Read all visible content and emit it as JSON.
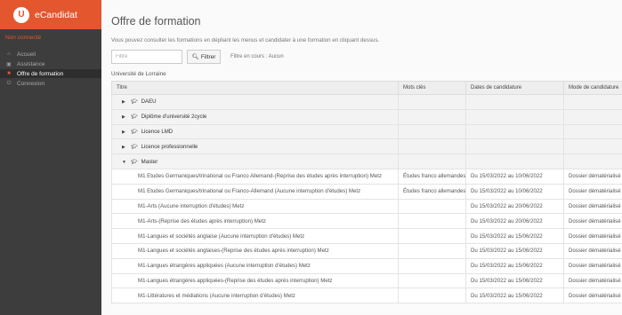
{
  "app": {
    "logo_letter": "U",
    "title": "eCandidat"
  },
  "user_status": "Non connecté",
  "nav": [
    {
      "icon": "home-icon",
      "glyph": "⌂",
      "label": "Accueil",
      "active": false
    },
    {
      "icon": "assistance-icon",
      "glyph": "▣",
      "label": "Assistance",
      "active": false
    },
    {
      "icon": "flag-icon",
      "glyph": "■",
      "label": "Offre de formation",
      "active": true
    },
    {
      "icon": "power-icon",
      "glyph": "⏻",
      "label": "Connexion",
      "active": false
    }
  ],
  "page": {
    "title": "Offre de formation",
    "intro": "Vous pouvez consulter les formations en dépliant les menus et candidater à une formation en cliquant dessus.",
    "filter_placeholder": "Filtre",
    "filter_button": "Filtrer",
    "filter_status": "Filtre en cours : Aucun",
    "university": "Université de Lorraine"
  },
  "table": {
    "headers": [
      "Titre",
      "Mots clés",
      "Dates de candidature",
      "Mode de candidature"
    ],
    "groups": [
      {
        "label": "DAEU",
        "expanded": false
      },
      {
        "label": "Diplôme d'université 2cycle",
        "expanded": false
      },
      {
        "label": "Licence LMD",
        "expanded": false
      },
      {
        "label": "Licence professionnelle",
        "expanded": false
      },
      {
        "label": "Master",
        "expanded": true
      }
    ],
    "rows": [
      {
        "title": "M1 Etudes Germaniques/trinational ou Franco Allemand-(Reprise des études après interruption) Metz",
        "keywords": "Études franco allemandes",
        "dates": "Du 15/03/2022 au 10/06/2022",
        "mode": "Dossier dématérialisé"
      },
      {
        "title": "M1 Etudes Germaniques/trinational ou Franco-Allemand (Aucune interruption d'études) Metz",
        "keywords": "Études franco allemandes",
        "dates": "Du 15/03/2022 au 10/06/2022",
        "mode": "Dossier dématérialisé"
      },
      {
        "title": "M1-Arts (Aucune interruption d'études) Metz",
        "keywords": "",
        "dates": "Du 15/03/2022 au 20/06/2022",
        "mode": "Dossier dématérialisé"
      },
      {
        "title": "M1-Arts-(Reprise des études après interruption) Metz",
        "keywords": "",
        "dates": "Du 15/03/2022 au 20/06/2022",
        "mode": "Dossier dématérialisé"
      },
      {
        "title": "M1-Langues et sociétés anglaise (Aucune interruption d'études) Metz",
        "keywords": "",
        "dates": "Du 15/03/2022 au 15/06/2022",
        "mode": "Dossier dématérialisé"
      },
      {
        "title": "M1-Langues et sociétés anglaises-(Reprise des études après interruption) Metz",
        "keywords": "",
        "dates": "Du 15/03/2022 au 15/06/2022",
        "mode": "Dossier dématérialisé"
      },
      {
        "title": "M1-Langues étrangères appliquées (Aucune interruption d'études) Metz",
        "keywords": "",
        "dates": "Du 15/03/2022 au 15/06/2022",
        "mode": "Dossier dématérialisé"
      },
      {
        "title": "M1-Langues étrangères appliquées-(Reprise des études après interruption) Metz",
        "keywords": "",
        "dates": "Du 15/03/2022 au 15/06/2022",
        "mode": "Dossier dématérialisé"
      },
      {
        "title": "M1-Littératures et médiations (Aucune interruption d'études) Metz",
        "keywords": "",
        "dates": "Du 15/03/2022 au 15/06/2022",
        "mode": "Dossier dématérialisé"
      }
    ]
  }
}
